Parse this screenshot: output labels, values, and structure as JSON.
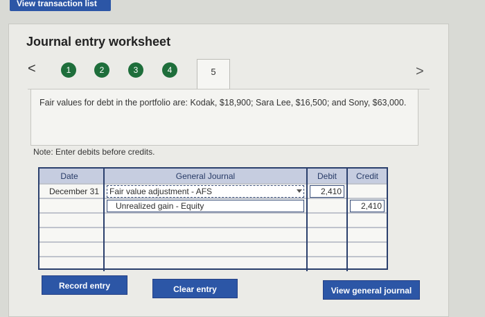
{
  "top_tab": {
    "label": "View transaction list"
  },
  "title": "Journal entry worksheet",
  "steps": [
    "1",
    "2",
    "3",
    "4",
    "5"
  ],
  "active_step": "5",
  "description": "Fair values for debt in the portfolio are: Kodak, $18,900; Sara Lee, $16,500; and Sony, $63,000.",
  "note": "Note: Enter debits before credits.",
  "table": {
    "headers": [
      "Date",
      "General Journal",
      "Debit",
      "Credit"
    ],
    "rows": [
      {
        "date": "December 31",
        "account": "Fair value adjustment - AFS",
        "debit": "2,410",
        "credit": ""
      },
      {
        "date": "",
        "account": "Unrealized gain - Equity",
        "debit": "",
        "credit": "2,410"
      },
      {
        "date": "",
        "account": "",
        "debit": "",
        "credit": ""
      },
      {
        "date": "",
        "account": "",
        "debit": "",
        "credit": ""
      },
      {
        "date": "",
        "account": "",
        "debit": "",
        "credit": ""
      },
      {
        "date": "",
        "account": "",
        "debit": "",
        "credit": ""
      }
    ]
  },
  "buttons": {
    "record": "Record entry",
    "clear": "Clear entry",
    "view": "View general journal"
  },
  "colors": {
    "primary": "#2c56a6",
    "step_complete": "#1e6e3b",
    "table_border": "#2a3f6c",
    "table_header": "#c6cde0"
  }
}
